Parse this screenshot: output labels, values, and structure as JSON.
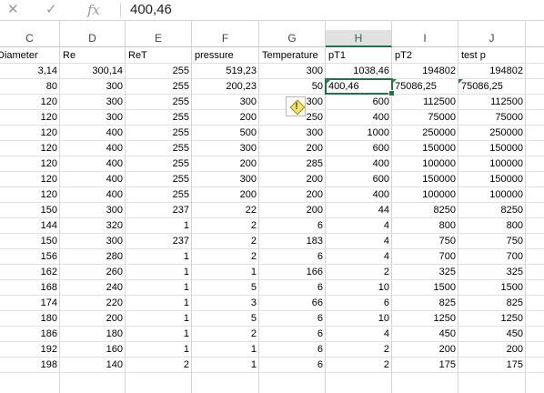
{
  "formula_bar": {
    "cancel_icon": "x-icon",
    "enter_icon": "check-icon",
    "fx_label": "fx",
    "value": "400,46"
  },
  "columns": [
    {
      "letter": "C",
      "header": "Diameter"
    },
    {
      "letter": "D",
      "header": "Re"
    },
    {
      "letter": "E",
      "header": "ReT"
    },
    {
      "letter": "F",
      "header": "pressure"
    },
    {
      "letter": "G",
      "header": "Temperature"
    },
    {
      "letter": "H",
      "header": "pT1"
    },
    {
      "letter": "I",
      "header": "pT2"
    },
    {
      "letter": "J",
      "header": "test p"
    }
  ],
  "rows": [
    [
      "3,14",
      "300,14",
      "255",
      "519,23",
      "300",
      "1038,46",
      "194802",
      "194802"
    ],
    [
      "80",
      "300",
      "255",
      "200,23",
      "50",
      "400,46",
      "75086,25",
      "75086,25"
    ],
    [
      "120",
      "300",
      "255",
      "300",
      "300",
      "600",
      "112500",
      "112500"
    ],
    [
      "120",
      "300",
      "255",
      "200",
      "250",
      "400",
      "75000",
      "75000"
    ],
    [
      "120",
      "400",
      "255",
      "500",
      "300",
      "1000",
      "250000",
      "250000"
    ],
    [
      "120",
      "400",
      "255",
      "300",
      "200",
      "600",
      "150000",
      "150000"
    ],
    [
      "120",
      "400",
      "255",
      "200",
      "285",
      "400",
      "100000",
      "100000"
    ],
    [
      "120",
      "400",
      "255",
      "300",
      "200",
      "600",
      "150000",
      "150000"
    ],
    [
      "120",
      "400",
      "255",
      "200",
      "200",
      "400",
      "100000",
      "100000"
    ],
    [
      "150",
      "300",
      "237",
      "22",
      "200",
      "44",
      "8250",
      "8250"
    ],
    [
      "144",
      "320",
      "1",
      "2",
      "6",
      "4",
      "800",
      "800"
    ],
    [
      "150",
      "300",
      "237",
      "2",
      "183",
      "4",
      "750",
      "750"
    ],
    [
      "156",
      "280",
      "1",
      "2",
      "6",
      "4",
      "700",
      "700"
    ],
    [
      "162",
      "260",
      "1",
      "1",
      "166",
      "2",
      "325",
      "325"
    ],
    [
      "168",
      "240",
      "1",
      "5",
      "6",
      "10",
      "1500",
      "1500"
    ],
    [
      "174",
      "220",
      "1",
      "3",
      "66",
      "6",
      "825",
      "825"
    ],
    [
      "180",
      "200",
      "1",
      "5",
      "6",
      "10",
      "1250",
      "1250"
    ],
    [
      "186",
      "180",
      "1",
      "2",
      "6",
      "4",
      "450",
      "450"
    ],
    [
      "192",
      "160",
      "1",
      "1",
      "6",
      "2",
      "200",
      "200"
    ],
    [
      "198",
      "140",
      "2",
      "1",
      "6",
      "2",
      "175",
      "175"
    ]
  ],
  "active_cell": "H",
  "colors": {
    "excel_green": "#217346",
    "gridline": "#d4d4d4",
    "header_selected_bg": "#e1e1e1"
  }
}
